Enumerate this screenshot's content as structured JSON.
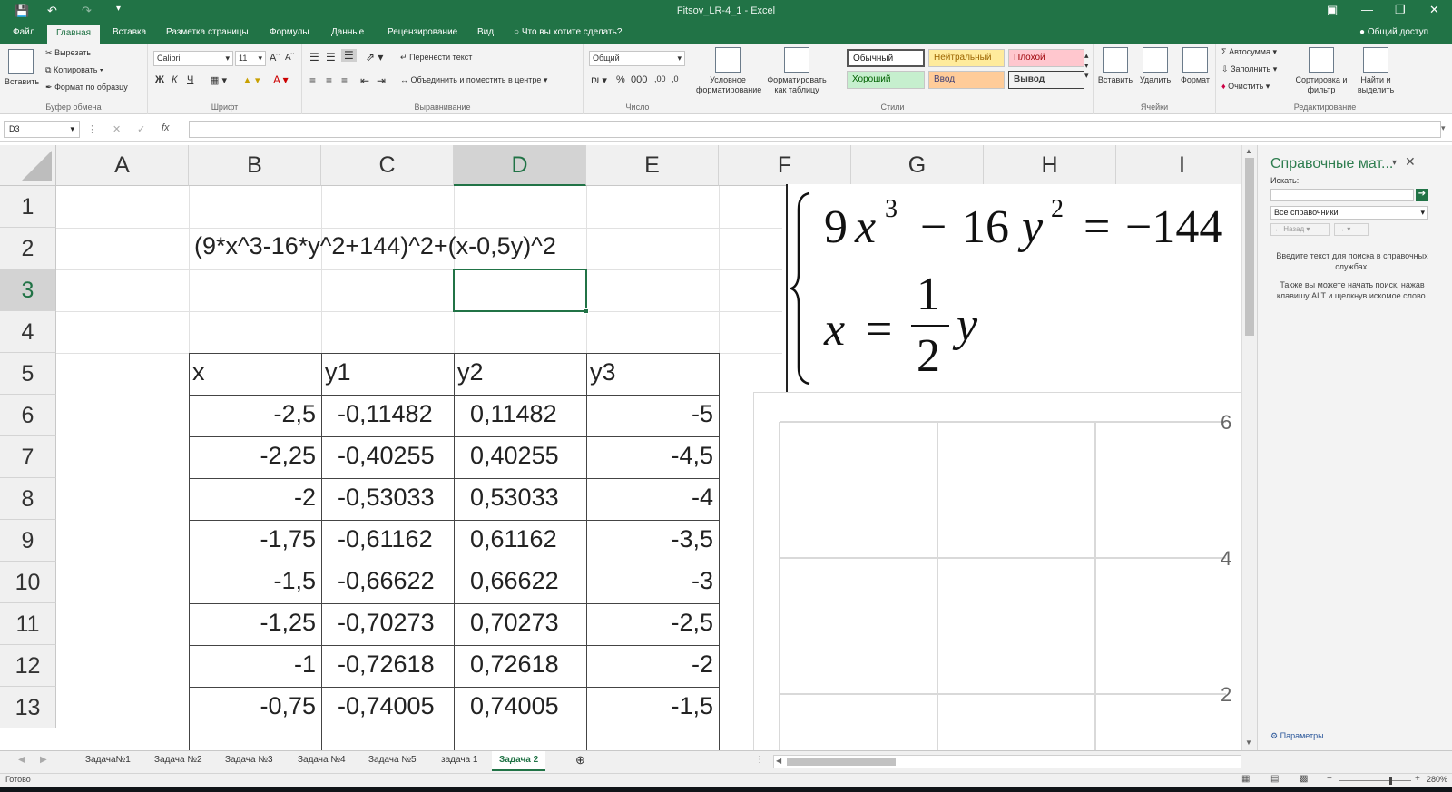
{
  "title": "Fitsov_LR-4_1 - Excel",
  "ribbon_tabs": [
    "Файл",
    "Главная",
    "Вставка",
    "Разметка страницы",
    "Формулы",
    "Данные",
    "Рецензирование",
    "Вид"
  ],
  "tell_me": "Что вы хотите сделать?",
  "share": "Общий доступ",
  "clipboard": {
    "paste": "Вставить",
    "cut": "Вырезать",
    "copy": "Копировать",
    "format_painter": "Формат по образцу",
    "label": "Буфер обмена"
  },
  "font": {
    "name": "Calibri",
    "size": "11",
    "bold": "Ж",
    "italic": "К",
    "underline": "Ч",
    "label": "Шрифт"
  },
  "alignment": {
    "wrap": "Перенести текст",
    "merge": "Объединить и поместить в центре",
    "label": "Выравнивание"
  },
  "number": {
    "format": "Общий",
    "label": "Число"
  },
  "styles": {
    "conditional": "Условное форматирование",
    "format_table": "Форматировать как таблицу",
    "normal": "Обычный",
    "neutral": "Нейтральный",
    "bad": "Плохой",
    "good": "Хороший",
    "input": "Ввод",
    "output": "Вывод",
    "label": "Стили"
  },
  "cells": {
    "insert": "Вставить",
    "delete": "Удалить",
    "format": "Формат",
    "label": "Ячейки"
  },
  "editing": {
    "autosum": "Автосумма",
    "fill": "Заполнить",
    "clear": "Очистить",
    "sort": "Сортировка и фильтр",
    "find": "Найти и выделить",
    "label": "Редактирование"
  },
  "name_box": "D3",
  "fx": "fx",
  "columns": [
    "A",
    "B",
    "C",
    "D",
    "E",
    "F",
    "G",
    "H",
    "I"
  ],
  "rows": [
    "1",
    "2",
    "3",
    "4",
    "5",
    "6",
    "7",
    "8",
    "9",
    "10",
    "11",
    "12",
    "13"
  ],
  "formula_text": "(9*x^3-16*y^2+144)^2+(x-0,5y)^2",
  "table_headers": [
    "x",
    "y1",
    "y2",
    "y3"
  ],
  "table_rows": [
    [
      "-2,5",
      "-0,11482",
      "0,11482",
      "-5"
    ],
    [
      "-2,25",
      "-0,40255",
      "0,40255",
      "-4,5"
    ],
    [
      "-2",
      "-0,53033",
      "0,53033",
      "-4"
    ],
    [
      "-1,75",
      "-0,61162",
      "0,61162",
      "-3,5"
    ],
    [
      "-1,5",
      "-0,66622",
      "0,66622",
      "-3"
    ],
    [
      "-1,25",
      "-0,70273",
      "0,70273",
      "-2,5"
    ],
    [
      "-1",
      "-0,72618",
      "0,72618",
      "-2"
    ],
    [
      "-0,75",
      "-0,74005",
      "0,74005",
      "-1,5"
    ]
  ],
  "equation": {
    "l1_a": "9",
    "l1_x": "x",
    "l1_e1": "3",
    "l1_minus": "−",
    "l1_b": "16",
    "l1_y": "y",
    "l1_e2": "2",
    "l1_eq": "=",
    "l1_rhs": "−144",
    "l2_x": "x",
    "l2_eq": "=",
    "l2_num": "1",
    "l2_den": "2",
    "l2_y": "y"
  },
  "chart_ticks": [
    "6",
    "4",
    "2"
  ],
  "pane": {
    "title": "Справочные мат...",
    "search_label": "Искать:",
    "source": "Все справочники",
    "back": "Назад",
    "info1": "Введите текст для поиска в справочных службах.",
    "info2": "Также вы можете начать поиск, нажав клавишу ALT и щелкнув искомое слово.",
    "params": "Параметры..."
  },
  "sheets": [
    "Задача№1",
    "Задача №2",
    "Задача №3",
    "Задача №4",
    "Задача №5",
    "задача 1",
    "Задача 2"
  ],
  "status": {
    "ready": "Готово",
    "zoom": "280%"
  }
}
